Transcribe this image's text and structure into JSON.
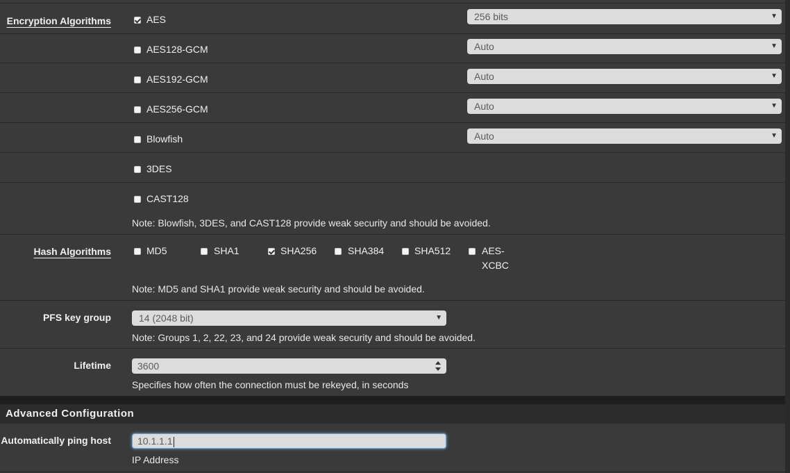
{
  "encryption": {
    "label": "Encryption Algorithms",
    "items": [
      {
        "name": "AES",
        "checked": true,
        "select": "256 bits"
      },
      {
        "name": "AES128-GCM",
        "checked": false,
        "select": "Auto"
      },
      {
        "name": "AES192-GCM",
        "checked": false,
        "select": "Auto"
      },
      {
        "name": "AES256-GCM",
        "checked": false,
        "select": "Auto"
      },
      {
        "name": "Blowfish",
        "checked": false,
        "select": "Auto"
      },
      {
        "name": "3DES",
        "checked": false
      },
      {
        "name": "CAST128",
        "checked": false
      }
    ],
    "note": "Note: Blowfish, 3DES, and CAST128 provide weak security and should be avoided."
  },
  "hash": {
    "label": "Hash Algorithms",
    "items": [
      {
        "name": "MD5",
        "checked": false
      },
      {
        "name": "SHA1",
        "checked": false
      },
      {
        "name": "SHA256",
        "checked": true
      },
      {
        "name": "SHA384",
        "checked": false
      },
      {
        "name": "SHA512",
        "checked": false
      },
      {
        "name": "AES-",
        "name2": "XCBC",
        "checked": false
      }
    ],
    "note": "Note: MD5 and SHA1 provide weak security and should be avoided."
  },
  "pfs": {
    "label": "PFS key group",
    "value": "14 (2048 bit)",
    "note": "Note: Groups 1, 2, 22, 23, and 24 provide weak security and should be avoided."
  },
  "lifetime": {
    "label": "Lifetime",
    "value": "3600",
    "help": "Specifies how often the connection must be rekeyed, in seconds"
  },
  "advanced": {
    "title": "Advanced Configuration",
    "ping_label": "Automatically ping host",
    "ping_value": "10.1.1.1",
    "ping_help": "IP Address"
  }
}
